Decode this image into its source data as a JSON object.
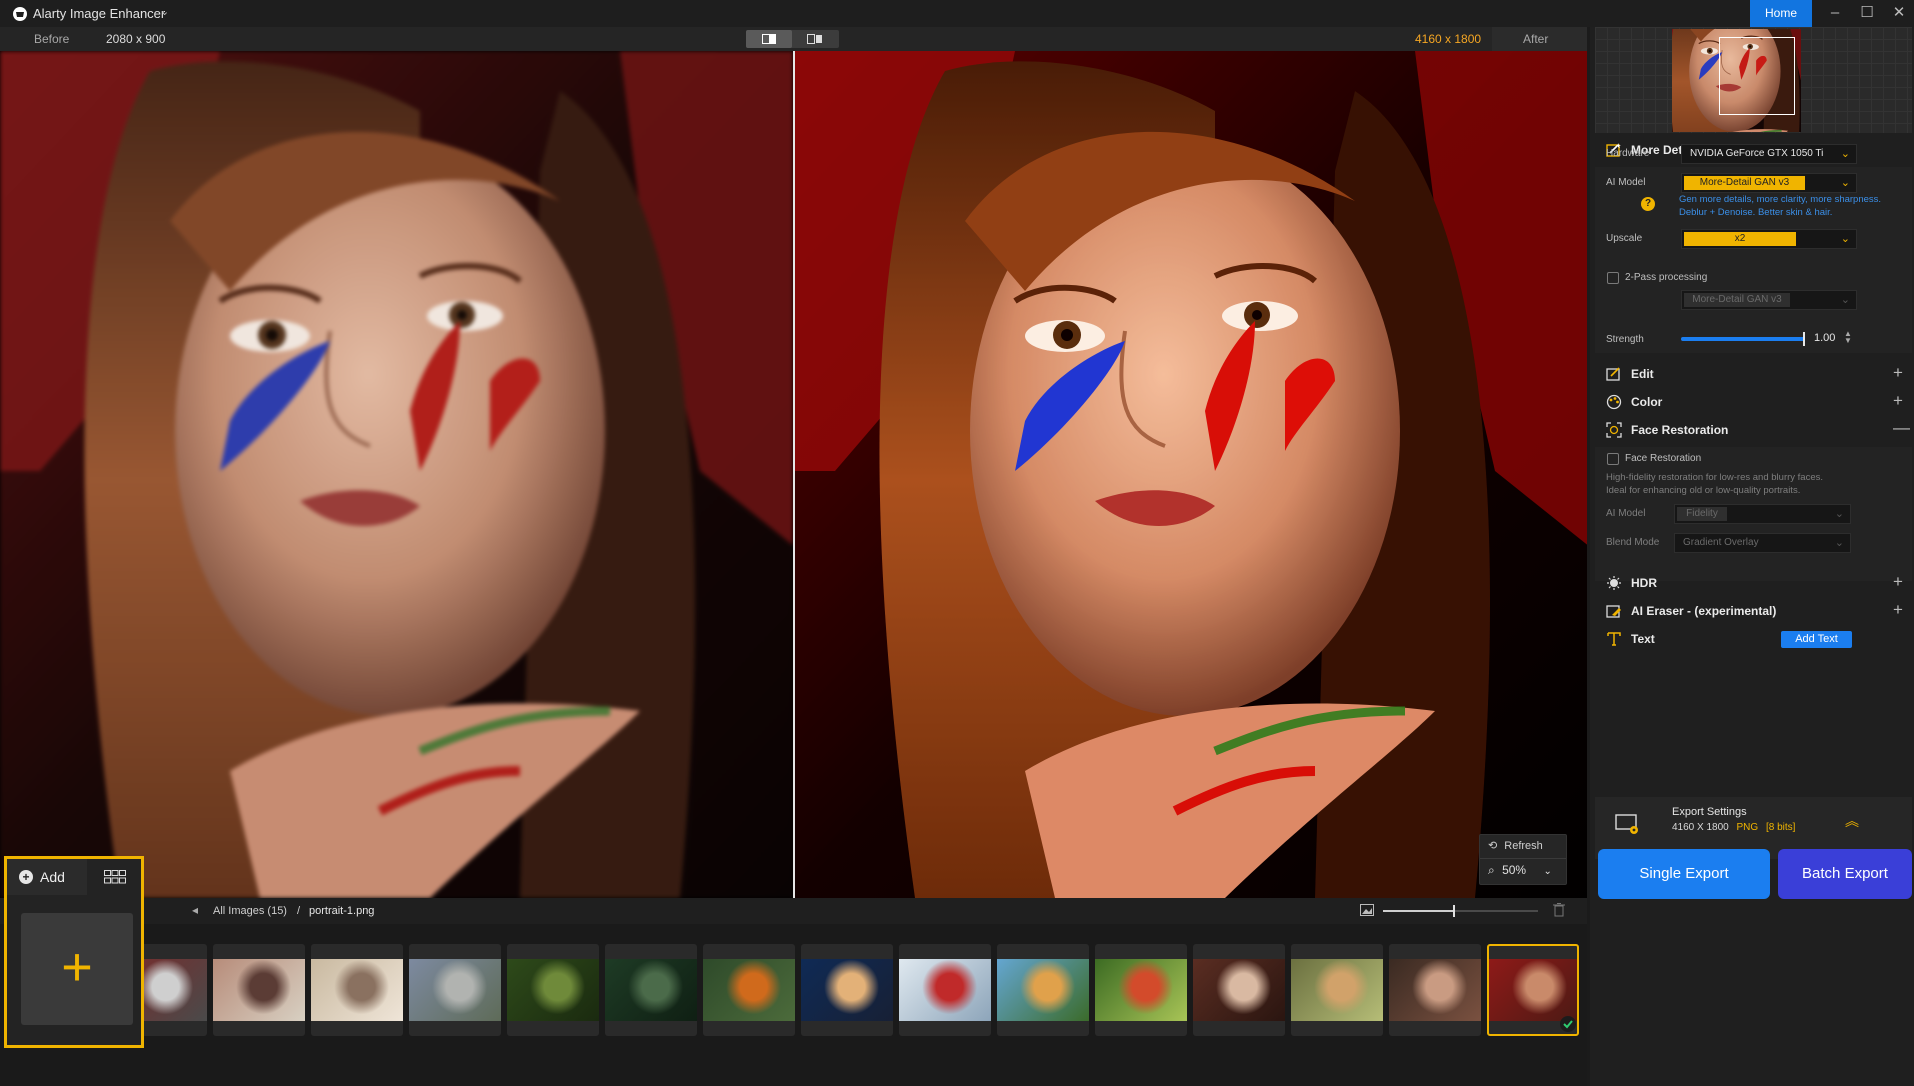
{
  "app": {
    "title": "Alarty Image Enhancer",
    "home_label": "Home"
  },
  "viewbar": {
    "before_label": "Before",
    "before_dim": "2080 x 900",
    "after_dim": "4160 x 1800",
    "after_label": "After"
  },
  "zoom": {
    "refresh_label": "Refresh",
    "zoom_value": "50%"
  },
  "breadcrumb": {
    "all_images": "All Images (15)",
    "separator": "/",
    "current_file": "portrait-1.png"
  },
  "add_panel": {
    "add_label": "Add"
  },
  "filmstrip": {
    "thumbnail_size": 0.45,
    "thumbs": [
      {
        "name": "thumb-red-car",
        "palette": [
          "#7a2b2b",
          "#cfcfcf",
          "#4a4a4a"
        ]
      },
      {
        "name": "thumb-family",
        "palette": [
          "#b78c7a",
          "#5b3c35",
          "#d8d0c2"
        ]
      },
      {
        "name": "thumb-wedding",
        "palette": [
          "#c9b9a0",
          "#8a7160",
          "#efe5d8"
        ]
      },
      {
        "name": "thumb-stroller",
        "palette": [
          "#7d8aa0",
          "#b1b3b0",
          "#5e6b58"
        ]
      },
      {
        "name": "thumb-plant",
        "palette": [
          "#2e4a1a",
          "#6f8a3a",
          "#1a2a0f"
        ]
      },
      {
        "name": "thumb-heron",
        "palette": [
          "#1e3b25",
          "#4b6b4a",
          "#0f1f13"
        ]
      },
      {
        "name": "thumb-child",
        "palette": [
          "#2e4a2a",
          "#d06a1c",
          "#4c6b3b"
        ]
      },
      {
        "name": "thumb-dog-blue",
        "palette": [
          "#0f2a55",
          "#e3b178",
          "#172035"
        ]
      },
      {
        "name": "thumb-red-plane",
        "palette": [
          "#dfe8ef",
          "#c02a2a",
          "#8da5ba"
        ]
      },
      {
        "name": "thumb-illustration",
        "palette": [
          "#64a6d1",
          "#e0a14b",
          "#3b6b2a"
        ]
      },
      {
        "name": "thumb-girl-flowers",
        "palette": [
          "#3c6b23",
          "#d34b2b",
          "#a8c456"
        ]
      },
      {
        "name": "thumb-portrait-old",
        "palette": [
          "#5a2d22",
          "#d9b9a2",
          "#2a1510"
        ]
      },
      {
        "name": "thumb-puppies",
        "palette": [
          "#6b7040",
          "#d1a26a",
          "#b6bd77"
        ]
      },
      {
        "name": "thumb-smiling-woman",
        "palette": [
          "#3a2a22",
          "#c99b82",
          "#7a5140"
        ]
      },
      {
        "name": "thumb-portrait-1",
        "palette": [
          "#8e1a18",
          "#c98a6a",
          "#4b1a14"
        ],
        "selected": true
      }
    ]
  },
  "panel": {
    "section_main": {
      "title": "More Details AI"
    },
    "hardware": {
      "label": "Hardware",
      "value": "NVIDIA GeForce GTX 1050 Ti"
    },
    "ai_model": {
      "label": "AI Model",
      "value": "More-Detail GAN  v3",
      "desc1": "Gen more details, more clarity, more sharpness.",
      "desc2": "Deblur + Denoise. Better skin & hair."
    },
    "upscale": {
      "label": "Upscale",
      "value": "x2"
    },
    "two_pass": {
      "label": "2-Pass processing",
      "model_value": "More-Detail GAN  v3"
    },
    "strength": {
      "label": "Strength",
      "value": "1.00",
      "level": 1.0
    },
    "edit": {
      "title": "Edit"
    },
    "color": {
      "title": "Color"
    },
    "face_restoration": {
      "title": "Face Restoration",
      "checkbox_label": "Face Restoration",
      "desc1": "High-fidelity restoration for low-res and blurry faces.",
      "desc2": "Ideal for enhancing old or low-quality portraits.",
      "ai_model_label": "AI Model",
      "ai_model_value": "Fidelity",
      "blend_label": "Blend Mode",
      "blend_value": "Gradient Overlay"
    },
    "hdr": {
      "title": "HDR"
    },
    "ai_eraser": {
      "title": "AI Eraser - (experimental)"
    },
    "text": {
      "title": "Text",
      "add_button": "Add Text"
    },
    "export": {
      "title": "Export Settings",
      "dim": "4160 X 1800",
      "format": "PNG",
      "bits": "[8 bits]"
    },
    "single_export": "Single Export",
    "batch_export": "Batch Export"
  },
  "colors": {
    "accent": "#f0b400",
    "primary_blue": "#1b7ef0",
    "batch_blue": "#3a3fd8",
    "link_blue": "#3b8fe8"
  }
}
